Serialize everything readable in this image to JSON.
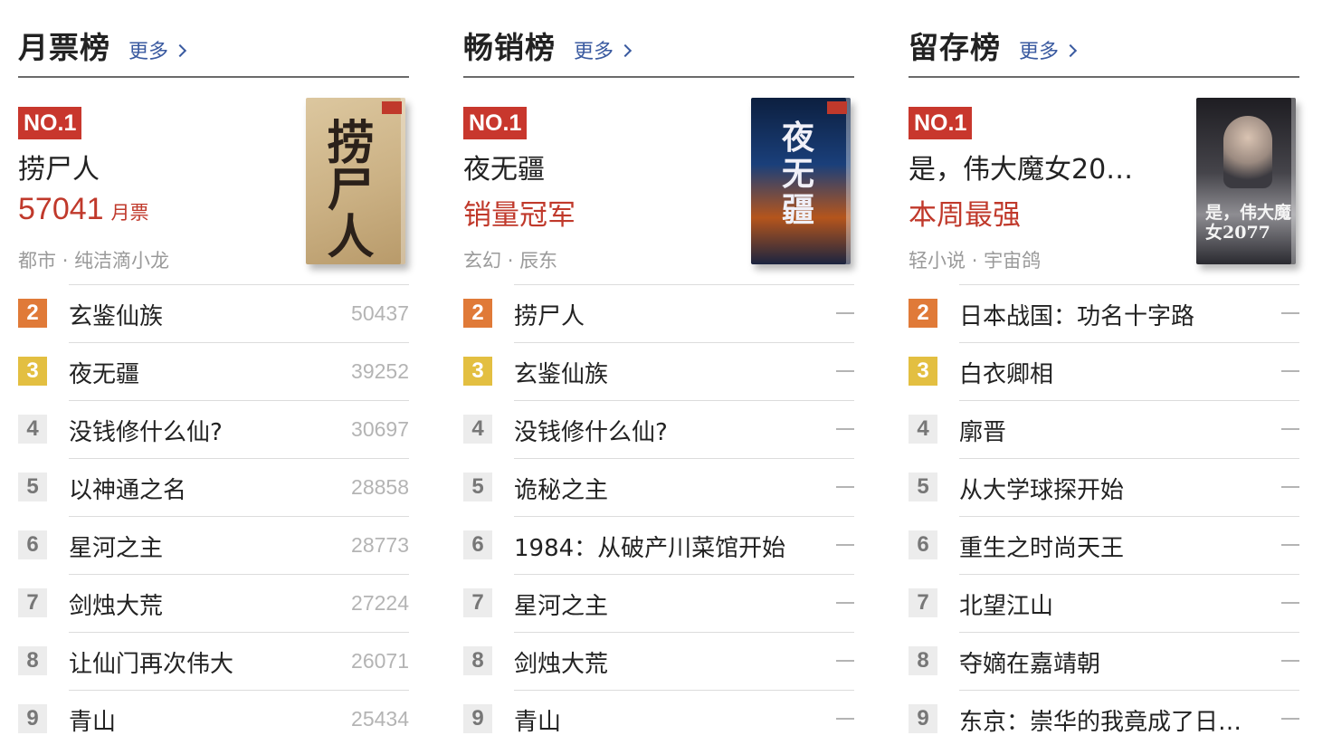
{
  "columns": [
    {
      "title": "月票榜",
      "more_label": "更多",
      "top": {
        "badge": "NO.1",
        "name": "捞尸人",
        "stat_value": "57041",
        "stat_unit": "月票",
        "genre": "都市",
        "separator": "·",
        "author": "纯洁滴小龙",
        "cover_text": "捞尸人"
      },
      "items": [
        {
          "rank": "2",
          "name": "玄鉴仙族",
          "value": "50437"
        },
        {
          "rank": "3",
          "name": "夜无疆",
          "value": "39252"
        },
        {
          "rank": "4",
          "name": "没钱修什么仙?",
          "value": "30697"
        },
        {
          "rank": "5",
          "name": "以神通之名",
          "value": "28858"
        },
        {
          "rank": "6",
          "name": "星河之主",
          "value": "28773"
        },
        {
          "rank": "7",
          "name": "剑烛大荒",
          "value": "27224"
        },
        {
          "rank": "8",
          "name": "让仙门再次伟大",
          "value": "26071"
        },
        {
          "rank": "9",
          "name": "青山",
          "value": "25434"
        }
      ]
    },
    {
      "title": "畅销榜",
      "more_label": "更多",
      "top": {
        "badge": "NO.1",
        "name": "夜无疆",
        "stat_text": "销量冠军",
        "genre": "玄幻",
        "separator": "·",
        "author": "辰东",
        "cover_text": "夜无疆"
      },
      "items": [
        {
          "rank": "2",
          "name": "捞尸人"
        },
        {
          "rank": "3",
          "name": "玄鉴仙族"
        },
        {
          "rank": "4",
          "name": "没钱修什么仙?"
        },
        {
          "rank": "5",
          "name": "诡秘之主"
        },
        {
          "rank": "6",
          "name": "1984：从破产川菜馆开始"
        },
        {
          "rank": "7",
          "name": "星河之主"
        },
        {
          "rank": "8",
          "name": "剑烛大荒"
        },
        {
          "rank": "9",
          "name": "青山"
        }
      ]
    },
    {
      "title": "留存榜",
      "more_label": "更多",
      "top": {
        "badge": "NO.1",
        "name": "是，伟大魔女20…",
        "stat_text": "本周最强",
        "genre": "轻小说",
        "separator": "·",
        "author": "宇宙鸽",
        "cover_text": "是，伟大魔女2077"
      },
      "items": [
        {
          "rank": "2",
          "name": "日本战国：功名十字路"
        },
        {
          "rank": "3",
          "name": "白衣卿相"
        },
        {
          "rank": "4",
          "name": "廓晋"
        },
        {
          "rank": "5",
          "name": "从大学球探开始"
        },
        {
          "rank": "6",
          "name": "重生之时尚天王"
        },
        {
          "rank": "7",
          "name": "北望江山"
        },
        {
          "rank": "8",
          "name": "夺嫡在嘉靖朝"
        },
        {
          "rank": "9",
          "name": "东京：崇华的我竟成了日…"
        }
      ]
    }
  ],
  "colors": {
    "accent_red": "#c0392b",
    "rank2": "#e07a38",
    "rank3": "#e3bf41",
    "link": "#3a5aa0"
  }
}
